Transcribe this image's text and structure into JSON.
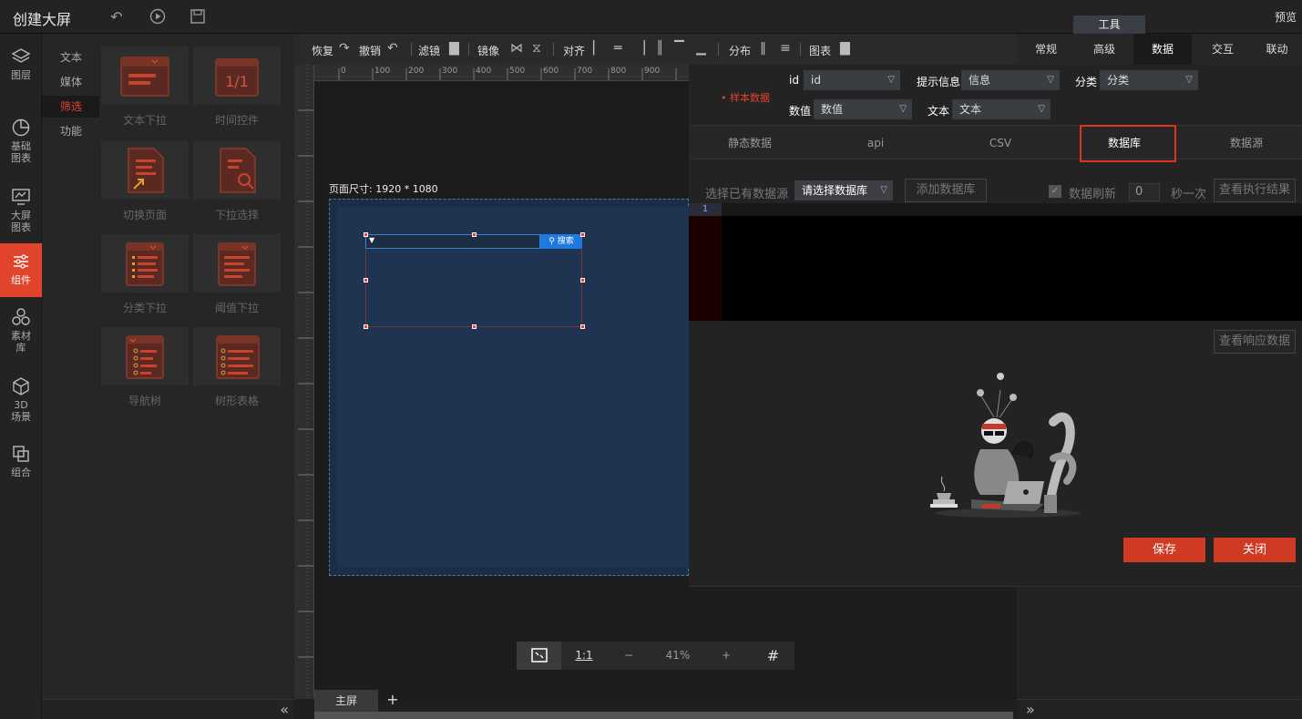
{
  "app": {
    "title": "创建大屏",
    "preview": "预览",
    "tools_tab": "工具"
  },
  "leftnav": [
    {
      "label": "图层",
      "icon": "layers-icon"
    },
    {
      "label": "基础\n图表",
      "icon": "pie-chart-icon"
    },
    {
      "label": "大屏\n图表",
      "icon": "screen-chart-icon"
    },
    {
      "label": "组件",
      "icon": "sliders-icon",
      "active": true
    },
    {
      "label": "素材\n库",
      "icon": "hexagons-icon"
    },
    {
      "label": "3D\n场景",
      "icon": "cube-icon"
    },
    {
      "label": "组合",
      "icon": "combine-icon"
    }
  ],
  "subnav": [
    {
      "label": "文本"
    },
    {
      "label": "媒体"
    },
    {
      "label": "筛选",
      "active": true
    },
    {
      "label": "功能"
    }
  ],
  "components": [
    {
      "name": "文本下拉"
    },
    {
      "name": "时间控件"
    },
    {
      "name": "切换页面"
    },
    {
      "name": "下拉选择"
    },
    {
      "name": "分类下拉"
    },
    {
      "name": "阈值下拉"
    },
    {
      "name": "导航树"
    },
    {
      "name": "树形表格"
    }
  ],
  "toolbar": {
    "restore": "恢复",
    "undo": "撤销",
    "filter": "滤镜",
    "mirror": "镜像",
    "align": "对齐",
    "distribute": "分布",
    "chart": "图表"
  },
  "ruler": {
    "ticks": [
      "0",
      "100",
      "200",
      "300",
      "400",
      "500",
      "600",
      "700",
      "800",
      "900"
    ]
  },
  "canvas": {
    "page_size": "页面尺寸: 1920 * 1080",
    "search_label": "搜索",
    "zoom": "41%",
    "one_to_one": "1:1",
    "minus": "−",
    "plus": "+"
  },
  "sheets": {
    "main": "主屏",
    "add": "+"
  },
  "righttabs": [
    {
      "label": "常规"
    },
    {
      "label": "高级"
    },
    {
      "label": "数据",
      "active": true
    },
    {
      "label": "交互"
    },
    {
      "label": "联动"
    }
  ],
  "modal": {
    "sample_data": "• 样本数据",
    "fields": {
      "id_label": "id",
      "id_value": "id",
      "tip_label": "提示信息",
      "tip_value": "信息",
      "cat_label": "分类",
      "cat_value": "分类",
      "num_label": "数值",
      "num_value": "数值",
      "text_label": "文本",
      "text_value": "文本"
    },
    "ds_tabs": [
      "静态数据",
      "api",
      "CSV",
      "数据库",
      "数据源"
    ],
    "select_label": "选择已有数据源",
    "select_value": "请选择数据库",
    "add_db": "添加数据库",
    "refresh_label": "数据刷新",
    "refresh_value": "0",
    "refresh_unit": "秒一次",
    "view_exec": "查看执行结果",
    "line_number": "1",
    "view_response": "查看响应数据",
    "save": "保存",
    "close": "关闭"
  }
}
